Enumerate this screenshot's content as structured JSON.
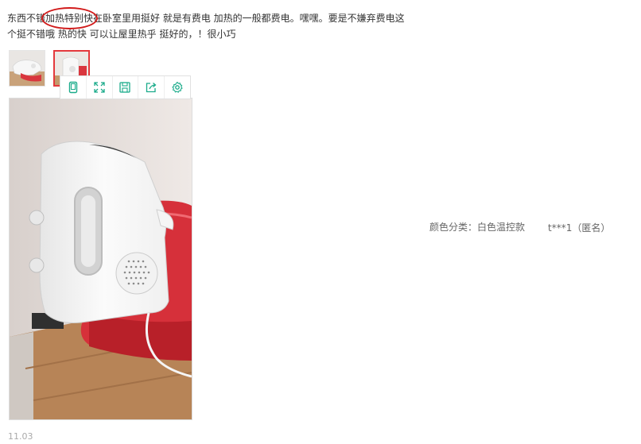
{
  "review": {
    "text_before": "东西不错",
    "text_highlight": "加热特别快",
    "text_after": "在卧室里用挺好 就是有费电 加热的一般都费电。嘿嘿。要是不嫌弃费电这个挺不错哦 热的快 可以让屋里热乎 挺好的，！很小巧"
  },
  "thumbnails": [
    {
      "name": "thumbnail-1",
      "selected": false
    },
    {
      "name": "thumbnail-2",
      "selected": true
    }
  ],
  "toolbar": {
    "icons": [
      "phone-view-icon",
      "fullscreen-icon",
      "save-icon",
      "share-icon",
      "settings-icon"
    ],
    "accent_color": "#1aab8a"
  },
  "meta": {
    "spec": "颜色分类：白色温控款",
    "user": "t***1（匿名）"
  },
  "date": "11.03",
  "colors": {
    "highlight_ring": "#d11a1a",
    "selected_border": "#e4393c"
  }
}
